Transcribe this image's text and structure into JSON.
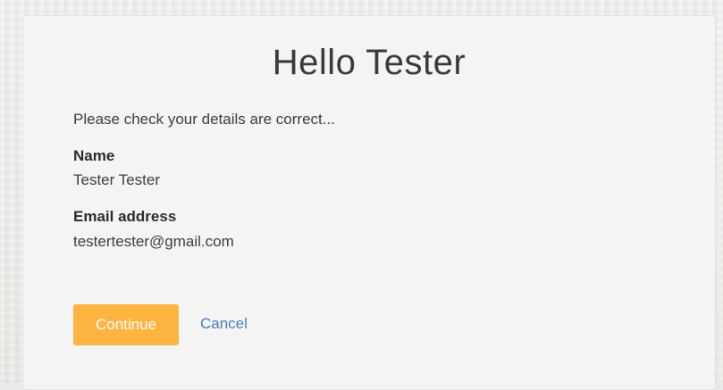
{
  "header": {
    "title": "Hello Tester"
  },
  "intro_text": "Please check your details are correct...",
  "details": {
    "name_label": "Name",
    "name_value": "Tester Tester",
    "email_label": "Email address",
    "email_value": "testertester@gmail.com"
  },
  "actions": {
    "continue_label": "Continue",
    "cancel_label": "Cancel"
  },
  "colors": {
    "primary_button": "#fdb441",
    "link": "#4a7cc1",
    "card_background": "#f4f4f4"
  }
}
